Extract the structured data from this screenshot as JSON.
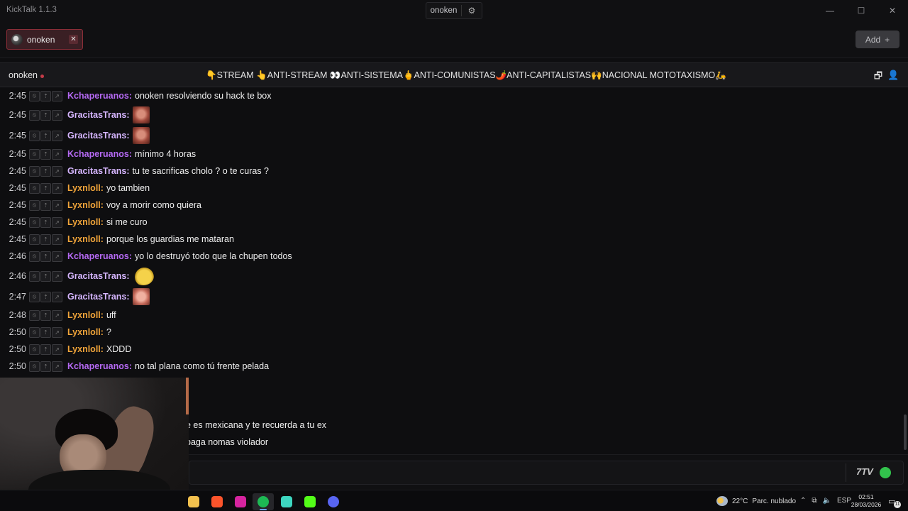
{
  "app": {
    "title": "KickTalk 1.1.3"
  },
  "titlebar": {
    "center_tab": "onoken",
    "center_tab_icon": "gear-icon",
    "window_controls": [
      "minimize-icon",
      "maximize-icon",
      "close-icon"
    ]
  },
  "tabs": {
    "items": [
      {
        "label": "onoken",
        "close": "✕"
      }
    ],
    "add_label": "Add",
    "add_icon": "+"
  },
  "channel": {
    "name": "onoken",
    "live": true,
    "stream_title": "👇STREAM 👆ANTI-STREAM 👀ANTI-SISTEMA🖕ANTI-COMUNISTAS🌶️ANTI-CAPITALISTAS🙌NACIONAL MOTOTAXISMO🛵",
    "icons": [
      "popout-icon",
      "user-icon"
    ]
  },
  "messages": [
    {
      "time": "2:45",
      "user": "Kchaperuanos:",
      "color": "kch",
      "text": "onoken resolviendo su hack te box"
    },
    {
      "time": "2:45",
      "user": "GracitasTrans:",
      "color": "grac",
      "text": "",
      "emote": "face"
    },
    {
      "time": "2:45",
      "user": "GracitasTrans:",
      "color": "grac",
      "text": "",
      "emote": "face"
    },
    {
      "time": "2:45",
      "user": "Kchaperuanos:",
      "color": "kch",
      "text": "mínimo 4 horas"
    },
    {
      "time": "2:45",
      "user": "GracitasTrans:",
      "color": "grac",
      "text": "tu te sacrificas cholo ? o te curas ?"
    },
    {
      "time": "2:45",
      "user": "Lyxnloll:",
      "color": "lyx",
      "text": "yo tambien"
    },
    {
      "time": "2:45",
      "user": "Lyxnloll:",
      "color": "lyx",
      "text": "voy a morir como quiera"
    },
    {
      "time": "2:45",
      "user": "Lyxnloll:",
      "color": "lyx",
      "text": "si me curo"
    },
    {
      "time": "2:45",
      "user": "Lyxnloll:",
      "color": "lyx",
      "text": "porque los guardias me mataran"
    },
    {
      "time": "2:46",
      "user": "Kchaperuanos:",
      "color": "kch",
      "text": "yo lo destruyó todo que la chupen todos"
    },
    {
      "time": "2:46",
      "user": "GracitasTrans:",
      "color": "grac",
      "text": "",
      "emote": "sleep"
    },
    {
      "time": "2:47",
      "user": "GracitasTrans:",
      "color": "grac",
      "text": "",
      "emote": "wow"
    },
    {
      "time": "2:48",
      "user": "Lyxnloll:",
      "color": "lyx",
      "text": "uff"
    },
    {
      "time": "2:50",
      "user": "Lyxnloll:",
      "color": "lyx",
      "text": "?"
    },
    {
      "time": "2:50",
      "user": "Lyxnloll:",
      "color": "lyx",
      "text": "XDDD"
    },
    {
      "time": "2:50",
      "user": "Kchaperuanos:",
      "color": "kch",
      "text": "no tal plana como tú frente pelada"
    }
  ],
  "partial_messages": [
    {
      "text": "e es mexicana y te recuerda a tu ex"
    },
    {
      "text": "paga nomas violador"
    }
  ],
  "input": {
    "emote_buttons": [
      "7tv-icon",
      "kick-emote-icon"
    ],
    "seventv_label": "7TV"
  },
  "taskbar": {
    "apps": [
      "file-explorer-icon",
      "brave-icon",
      "instagram-icon",
      "spotify-icon",
      "twitch-icon",
      "kick-icon",
      "discord-icon"
    ],
    "weather_temp": "22°C",
    "weather_desc": "Parc. nublado",
    "language": "ESP",
    "time": "02:51",
    "date": "28/03/2026",
    "notifications": "11",
    "colors": {
      "brave": "#fb542b",
      "instagram": "#d6249f",
      "spotify": "#1db954",
      "twitch": "#3dd6c0",
      "kick": "#53fc18",
      "discord": "#5865f2",
      "file": "#f2c14e"
    }
  }
}
